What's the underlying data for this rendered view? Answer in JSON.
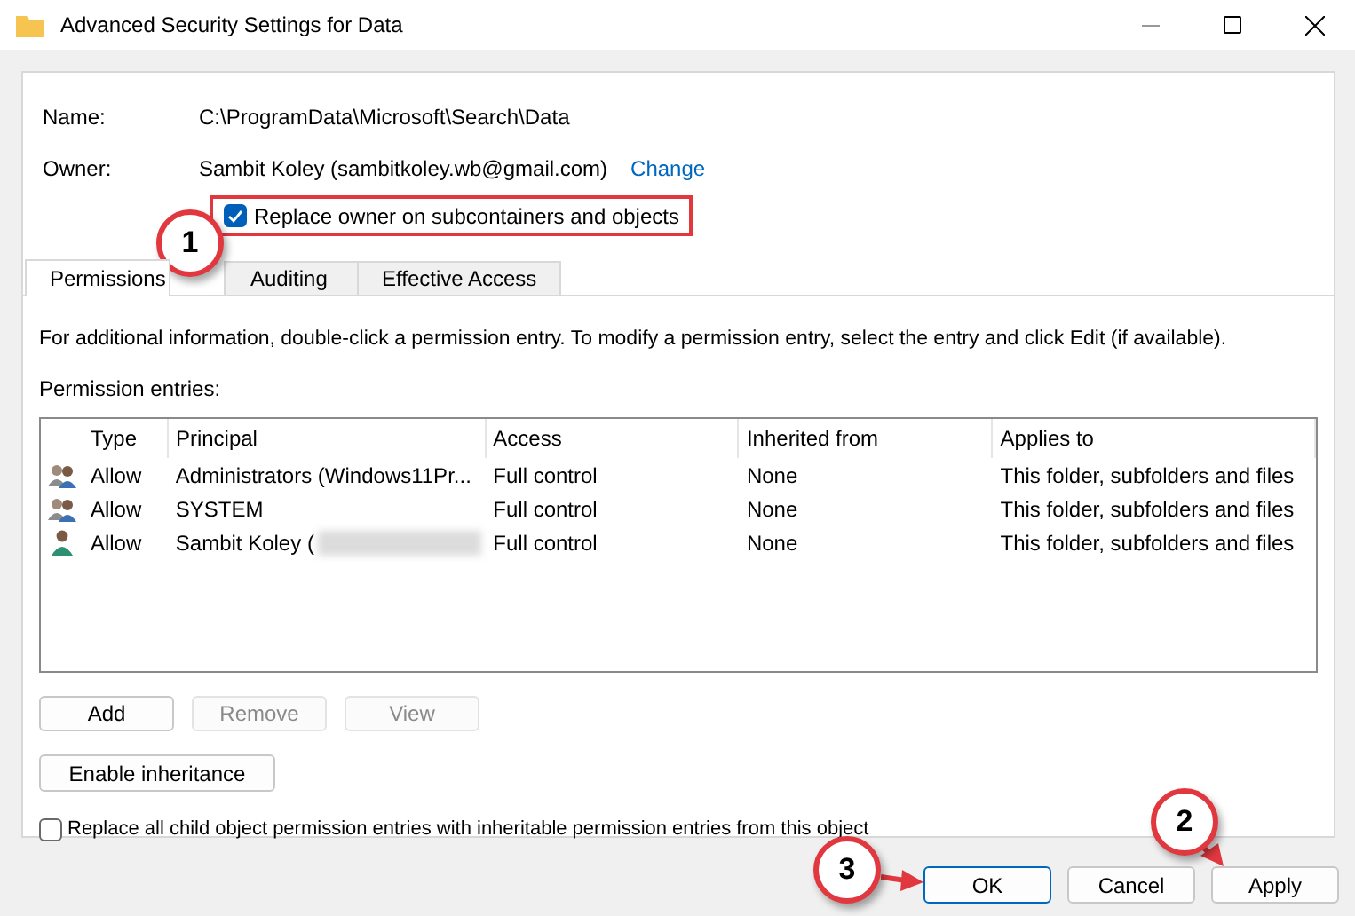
{
  "window": {
    "title": "Advanced Security Settings for Data"
  },
  "name": {
    "label": "Name:",
    "value": "C:\\ProgramData\\Microsoft\\Search\\Data"
  },
  "owner": {
    "label": "Owner:",
    "value": "Sambit Koley (sambitkoley.wb@gmail.com)",
    "link": "Change"
  },
  "replace_owner": {
    "label": "Replace owner on subcontainers and objects",
    "checked": true
  },
  "tabs": [
    {
      "label": "Permissions",
      "selected": true
    },
    {
      "label": "Auditing",
      "selected": false
    },
    {
      "label": "Effective Access",
      "selected": false
    }
  ],
  "info_text": "For additional information, double-click a permission entry. To modify a permission entry, select the entry and click Edit (if available).",
  "entries_label": "Permission entries:",
  "table": {
    "columns": [
      "Type",
      "Principal",
      "Access",
      "Inherited from",
      "Applies to"
    ],
    "rows": [
      {
        "kind": "group",
        "type": "Allow",
        "principal": "Administrators (Windows11Pr...",
        "redacted": false,
        "access": "Full control",
        "inherited_from": "None",
        "applies_to": "This folder, subfolders and files"
      },
      {
        "kind": "group",
        "type": "Allow",
        "principal": "SYSTEM",
        "redacted": false,
        "access": "Full control",
        "inherited_from": "None",
        "applies_to": "This folder, subfolders and files"
      },
      {
        "kind": "user",
        "type": "Allow",
        "principal": "Sambit Koley (",
        "redacted": true,
        "access": "Full control",
        "inherited_from": "None",
        "applies_to": "This folder, subfolders and files"
      }
    ]
  },
  "entry_buttons": [
    {
      "label": "Add",
      "disabled": false
    },
    {
      "label": "Remove",
      "disabled": true
    },
    {
      "label": "View",
      "disabled": true
    }
  ],
  "enable_inheritance": "Enable inheritance",
  "replace_child": {
    "label": "Replace all child object permission entries with inheritable permission entries from this object",
    "checked": false
  },
  "footer_buttons": [
    {
      "label": "OK",
      "default": true
    },
    {
      "label": "Cancel",
      "default": false
    },
    {
      "label": "Apply",
      "default": false
    }
  ],
  "callouts": [
    "1",
    "2",
    "3"
  ]
}
